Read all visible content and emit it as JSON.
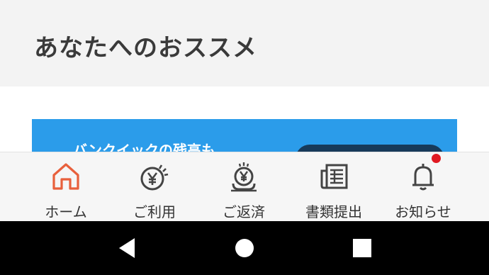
{
  "section": {
    "title": "あなたへのおススメ"
  },
  "banner": {
    "text": "バンクイックの残高も"
  },
  "tabs": [
    {
      "label": "ホーム",
      "icon": "home-icon",
      "active": true
    },
    {
      "label": "ご利用",
      "icon": "yen-coin-icon",
      "active": false
    },
    {
      "label": "ご返済",
      "icon": "yen-repay-icon",
      "active": false
    },
    {
      "label": "書類提出",
      "icon": "document-icon",
      "active": false
    },
    {
      "label": "お知らせ",
      "icon": "bell-icon",
      "active": false,
      "has_notification": true
    }
  ],
  "colors": {
    "accent": "#e8603c",
    "banner": "#2b9cea",
    "notification": "#e01921",
    "icon": "#444444"
  },
  "navigation": {
    "back": "back-icon",
    "home": "home-circle-icon",
    "recents": "recents-icon"
  }
}
